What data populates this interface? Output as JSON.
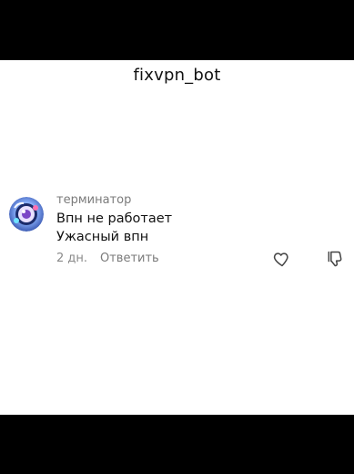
{
  "header": {
    "title": "fixvpn_bot"
  },
  "comment": {
    "username": "терминатор",
    "lines": [
      "Впн не работает",
      "Ужасный впн"
    ],
    "time": "2 дн.",
    "reply_label": "Ответить"
  },
  "icons": {
    "like": "heart-icon",
    "dislike": "thumbs-down-icon"
  }
}
